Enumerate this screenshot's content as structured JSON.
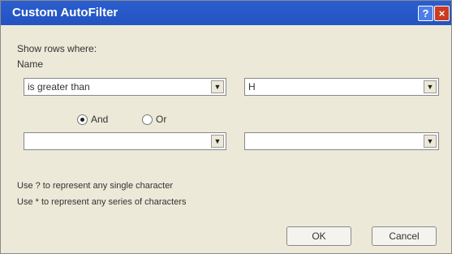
{
  "window": {
    "title": "Custom AutoFilter"
  },
  "instructions": "Show rows where:",
  "field_label": "Name",
  "criterion1": {
    "operator": "is greater than",
    "value": "H"
  },
  "logic": {
    "and_label": "And",
    "or_label": "Or",
    "selected": "and"
  },
  "criterion2": {
    "operator": "",
    "value": ""
  },
  "hints": [
    "Use ? to represent any single character",
    "Use * to represent any series of characters"
  ],
  "buttons": {
    "ok": "OK",
    "cancel": "Cancel"
  }
}
